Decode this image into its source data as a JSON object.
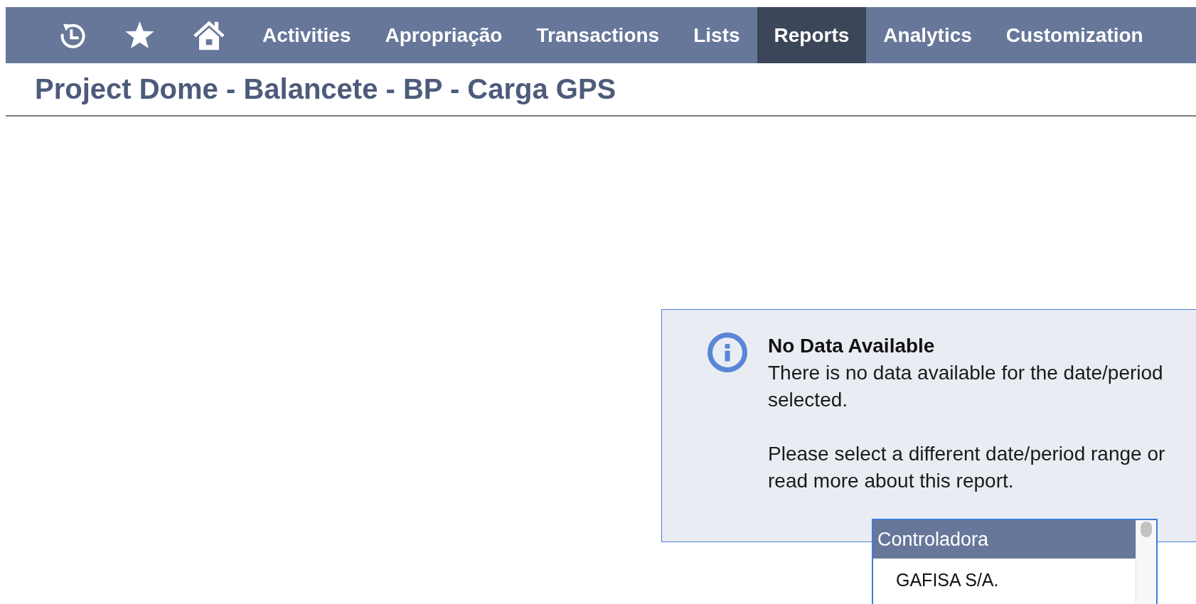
{
  "nav": {
    "items": [
      {
        "label": "Activities",
        "selected": false
      },
      {
        "label": "Apropriação",
        "selected": false
      },
      {
        "label": "Transactions",
        "selected": false
      },
      {
        "label": "Lists",
        "selected": false
      },
      {
        "label": "Reports",
        "selected": true
      },
      {
        "label": "Analytics",
        "selected": false
      },
      {
        "label": "Customization",
        "selected": false
      }
    ]
  },
  "page_title": "Project Dome - Balancete - BP - Carga GPS",
  "notice": {
    "title": "No Data Available",
    "paragraphs": [
      [
        "There is no data available for the date/period",
        "selected."
      ],
      [
        "Please select a different date/period range or",
        "read more about this report."
      ]
    ]
  },
  "dropdown": {
    "options": [
      {
        "label": "Controladora",
        "selected": true,
        "children": [
          {
            "label": "GAFISA S/A.",
            "selected": false
          }
        ]
      }
    ]
  }
}
